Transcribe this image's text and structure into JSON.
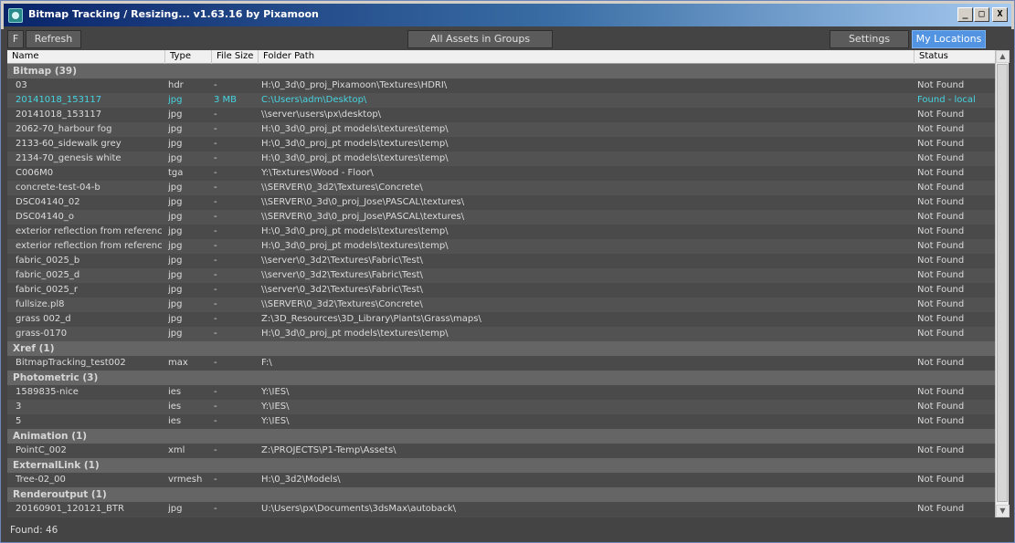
{
  "window": {
    "title": "Bitmap Tracking / Resizing... v1.63.16 by Pixamoon",
    "minimize": "_",
    "maximize": "□",
    "close": "X"
  },
  "toolbar": {
    "f_label": "F",
    "refresh_label": "Refresh",
    "all_assets_label": "All Assets in Groups",
    "settings_label": "Settings",
    "my_locations_label": "My Locations"
  },
  "columns": {
    "name": "Name",
    "type": "Type",
    "size": "File Size",
    "path": "Folder Path",
    "status": "Status"
  },
  "groups": [
    {
      "title": "Bitmap (39)",
      "rows": [
        [
          "03",
          "hdr",
          "-",
          "H:\\0_3d\\0_proj_Pixamoon\\Textures\\HDRI\\",
          "Not Found"
        ],
        [
          "20141018_153117",
          "jpg",
          "3 MB",
          "C:\\Users\\adm\\Desktop\\",
          "Found - local"
        ],
        [
          "20141018_153117",
          "jpg",
          "-",
          "\\\\server\\users\\px\\desktop\\",
          "Not Found"
        ],
        [
          "2062-70_harbour fog",
          "jpg",
          "-",
          "H:\\0_3d\\0_proj_pt models\\textures\\temp\\",
          "Not Found"
        ],
        [
          "2133-60_sidewalk grey",
          "jpg",
          "-",
          "H:\\0_3d\\0_proj_pt models\\textures\\temp\\",
          "Not Found"
        ],
        [
          "2134-70_genesis white",
          "jpg",
          "-",
          "H:\\0_3d\\0_proj_pt models\\textures\\temp\\",
          "Not Found"
        ],
        [
          "C006M0",
          "tga",
          "-",
          "Y:\\Textures\\Wood - Floor\\",
          "Not Found"
        ],
        [
          "concrete-test-04-b",
          "jpg",
          "-",
          "\\\\SERVER\\0_3d2\\Textures\\Concrete\\",
          "Not Found"
        ],
        [
          "DSC04140_02",
          "jpg",
          "-",
          "\\\\SERVER\\0_3d\\0_proj_Jose\\PASCAL\\textures\\",
          "Not Found"
        ],
        [
          "DSC04140_o",
          "jpg",
          "-",
          "\\\\SERVER\\0_3d\\0_proj_Jose\\PASCAL\\textures\\",
          "Not Found"
        ],
        [
          "exterior reflection from referenc...",
          "jpg",
          "-",
          "H:\\0_3d\\0_proj_pt models\\textures\\temp\\",
          "Not Found"
        ],
        [
          "exterior reflection from referenc...",
          "jpg",
          "-",
          "H:\\0_3d\\0_proj_pt models\\textures\\temp\\",
          "Not Found"
        ],
        [
          "fabric_0025_b",
          "jpg",
          "-",
          "\\\\server\\0_3d2\\Textures\\Fabric\\Test\\",
          "Not Found"
        ],
        [
          "fabric_0025_d",
          "jpg",
          "-",
          "\\\\server\\0_3d2\\Textures\\Fabric\\Test\\",
          "Not Found"
        ],
        [
          "fabric_0025_r",
          "jpg",
          "-",
          "\\\\server\\0_3d2\\Textures\\Fabric\\Test\\",
          "Not Found"
        ],
        [
          "fullsize.pl8",
          "jpg",
          "-",
          "\\\\SERVER\\0_3d2\\Textures\\Concrete\\",
          "Not Found"
        ],
        [
          "grass 002_d",
          "jpg",
          "-",
          "Z:\\3D_Resources\\3D_Library\\Plants\\Grass\\maps\\",
          "Not Found"
        ],
        [
          "grass-0170",
          "jpg",
          "-",
          "H:\\0_3d\\0_proj_pt models\\textures\\temp\\",
          "Not Found"
        ]
      ]
    },
    {
      "title": "Xref (1)",
      "rows": [
        [
          "BitmapTracking_test002",
          "max",
          "-",
          "F:\\",
          "Not Found"
        ]
      ]
    },
    {
      "title": "Photometric (3)",
      "rows": [
        [
          "1589835-nice",
          "ies",
          "-",
          "Y:\\IES\\",
          "Not Found"
        ],
        [
          "3",
          "ies",
          "-",
          "Y:\\IES\\",
          "Not Found"
        ],
        [
          "5",
          "ies",
          "-",
          "Y:\\IES\\",
          "Not Found"
        ]
      ]
    },
    {
      "title": "Animation (1)",
      "rows": [
        [
          "PointC_002",
          "xml",
          "-",
          "Z:\\PROJECTS\\P1-Temp\\Assets\\",
          "Not Found"
        ]
      ]
    },
    {
      "title": "ExternalLink (1)",
      "rows": [
        [
          "Tree-02_00",
          "vrmesh",
          "-",
          "H:\\0_3d2\\Models\\",
          "Not Found"
        ]
      ]
    },
    {
      "title": "Renderoutput (1)",
      "rows": [
        [
          "20160901_120121_BTR",
          "jpg",
          "-",
          "U:\\Users\\px\\Documents\\3dsMax\\autoback\\",
          "Not Found"
        ]
      ]
    }
  ],
  "scrollbar": {
    "up": "▲",
    "down": "▼"
  },
  "status_bar": {
    "found": "Found: 46"
  },
  "colors": {
    "found_local": "#46d4e0",
    "accent": "#5294e2"
  }
}
